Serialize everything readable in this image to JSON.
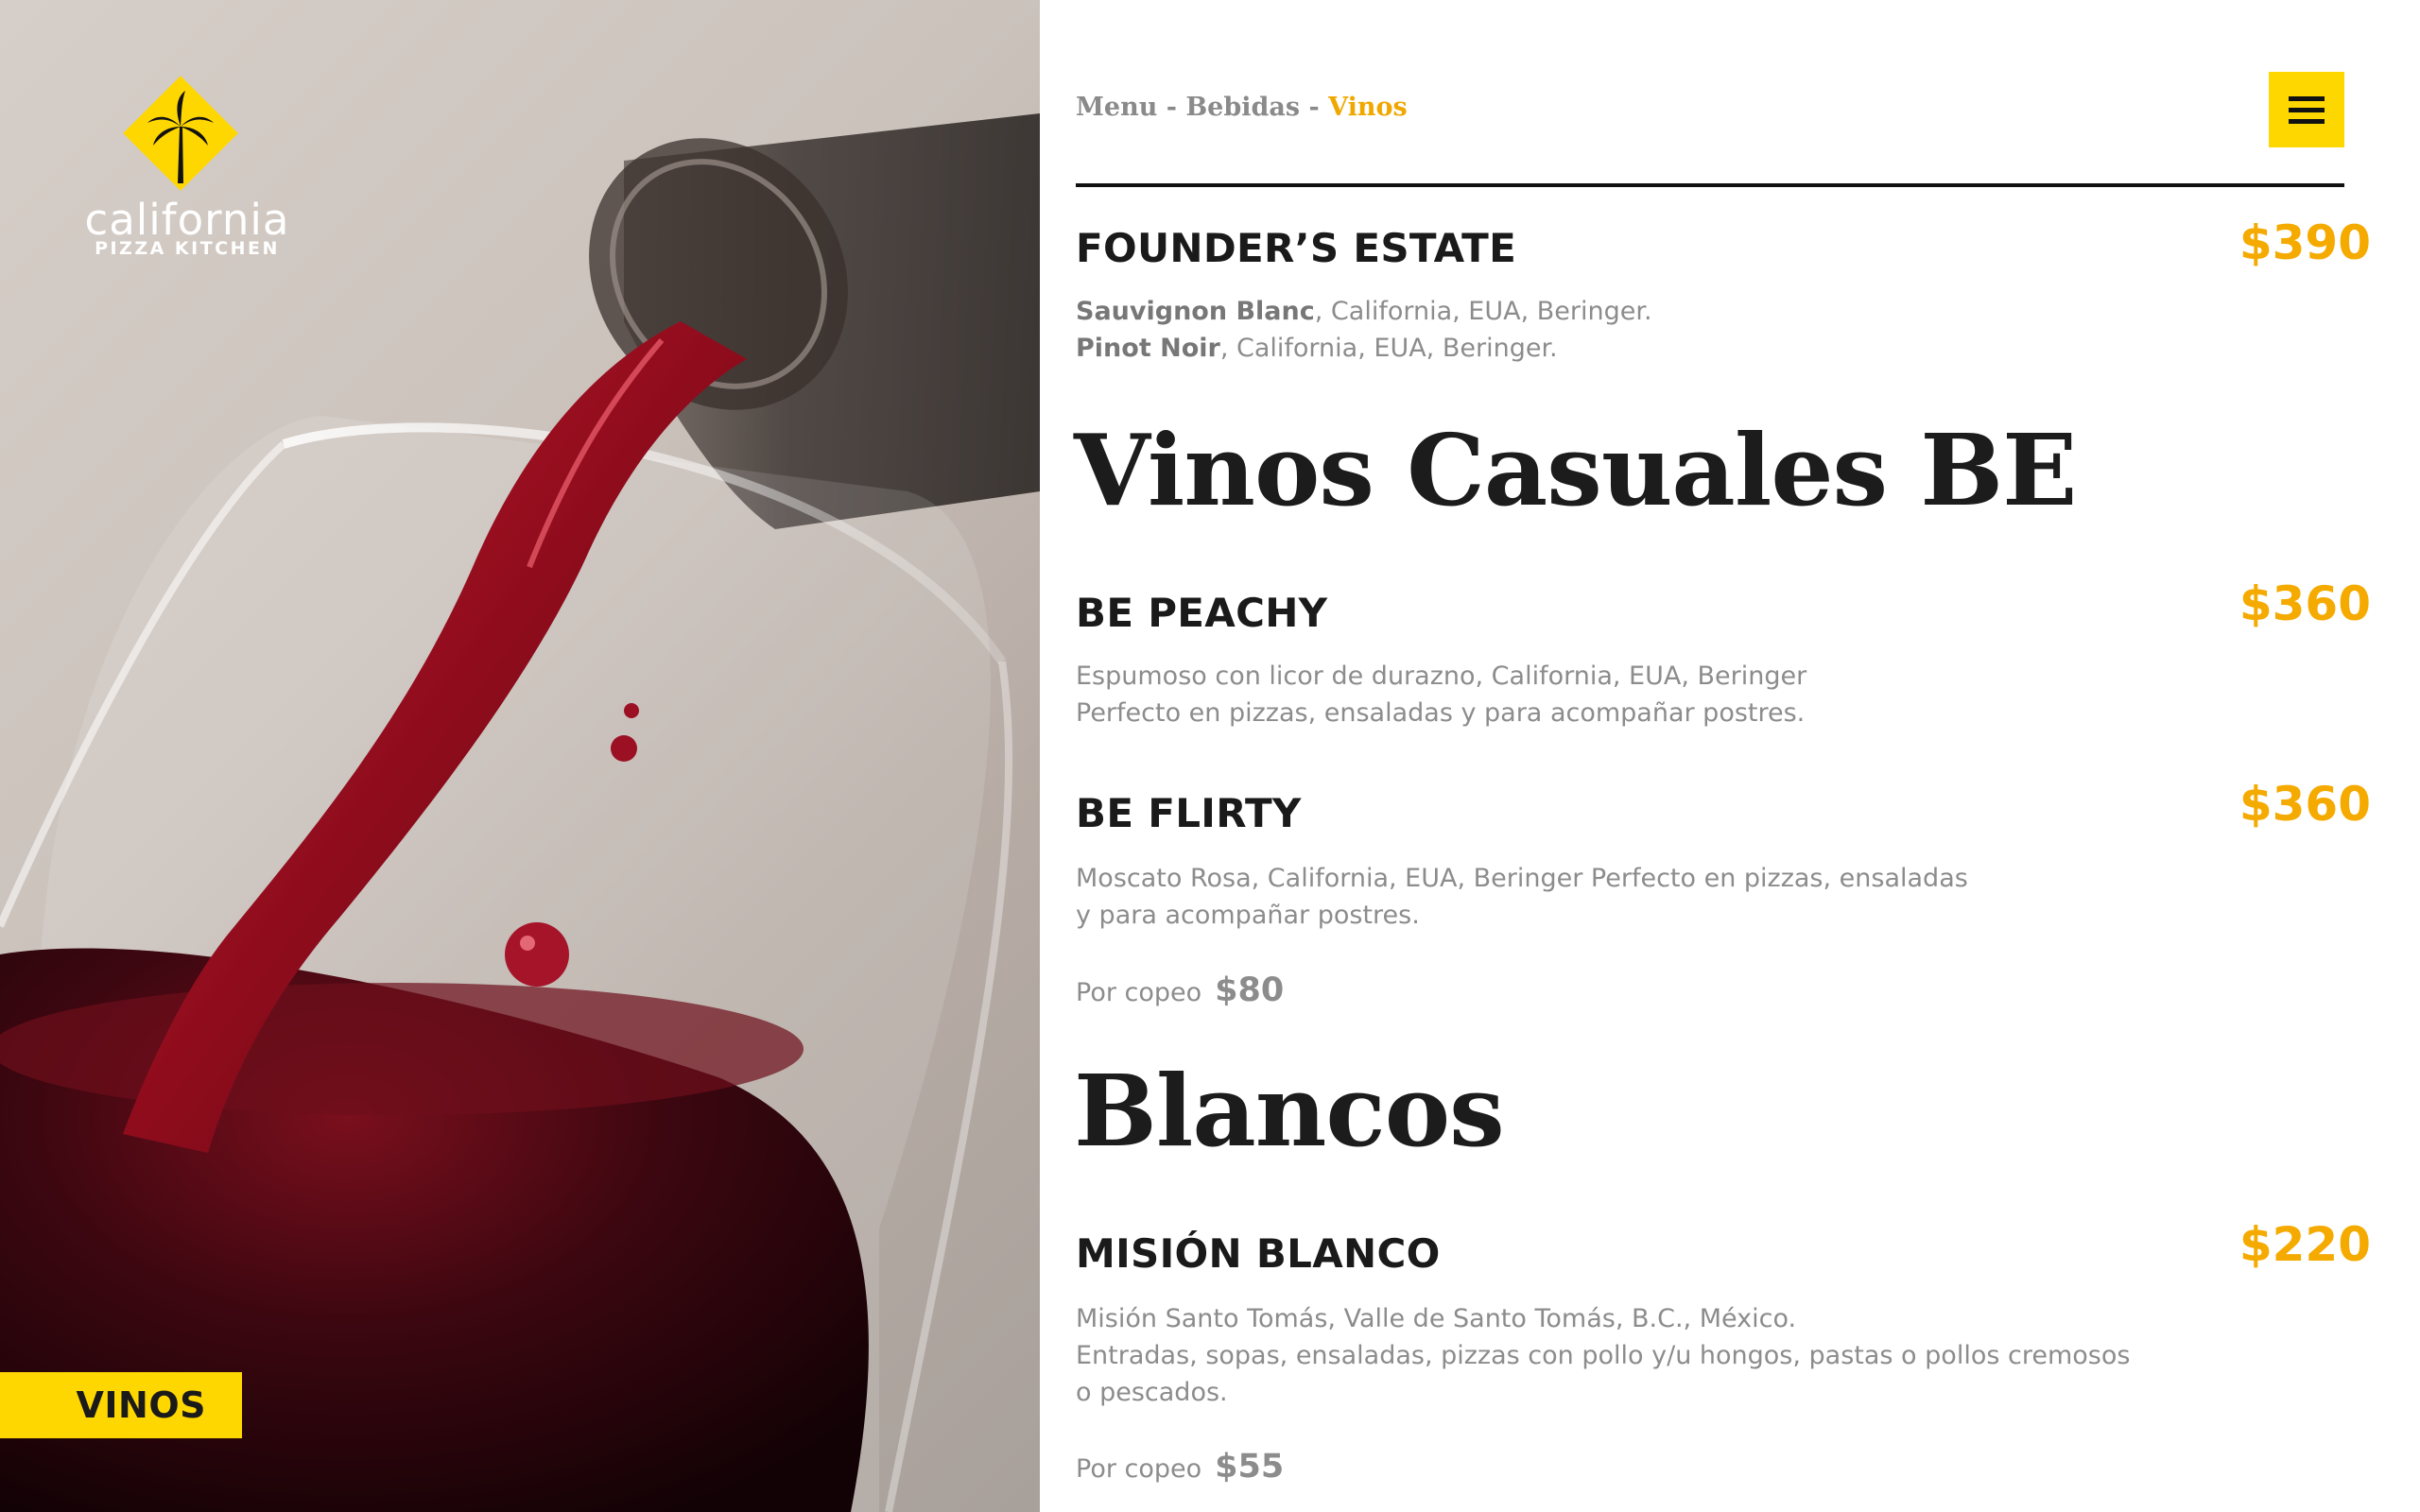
{
  "brand": {
    "wordmark": "california",
    "subword": "PIZZA KITCHEN",
    "logo_icon": "palm-tree-icon",
    "brand_yellow": "#FFD700"
  },
  "hero": {
    "section_tag": "VINOS"
  },
  "breadcrumb": {
    "items": [
      "Menu",
      "Bebidas"
    ],
    "separator": "-",
    "current": "Vinos"
  },
  "menu_button": {
    "icon": "hamburger-menu-icon"
  },
  "colors": {
    "accent": "#F5AA00",
    "text": "#1A1A1A",
    "muted": "#8C8C8C"
  },
  "items": [
    {
      "name": "FOUNDER’S ESTATE",
      "price": "$390",
      "desc_lines": [
        {
          "bold": "Sauvignon Blanc",
          "rest": ", California, EUA, Beringer."
        },
        {
          "bold": "Pinot Noir",
          "rest": ", California, EUA, Beringer."
        }
      ]
    },
    {
      "name": "BE PEACHY",
      "price": "$360",
      "desc_lines": [
        "Espumoso con licor de durazno, California, EUA, Beringer",
        "Perfecto en pizzas, ensaladas y para acompañar postres."
      ]
    },
    {
      "name": "BE FLIRTY",
      "price": "$360",
      "desc_lines": [
        "Moscato Rosa, California, EUA, Beringer Perfecto en pizzas, ensaladas",
        "y para acompañar postres."
      ],
      "copeo_label": "Por copeo",
      "copeo_price": "$80"
    },
    {
      "name": "MISIÓN BLANCO",
      "price": "$220",
      "desc_lines": [
        "Misión Santo Tomás, Valle de Santo Tomás, B.C., México.",
        "Entradas, sopas, ensaladas, pizzas con pollo y/u hongos, pastas o pollos cremosos",
        "o pescados."
      ],
      "copeo_label": "Por copeo",
      "copeo_price": "$55"
    }
  ],
  "sections": [
    "Vinos Casuales BE",
    "Blancos"
  ]
}
